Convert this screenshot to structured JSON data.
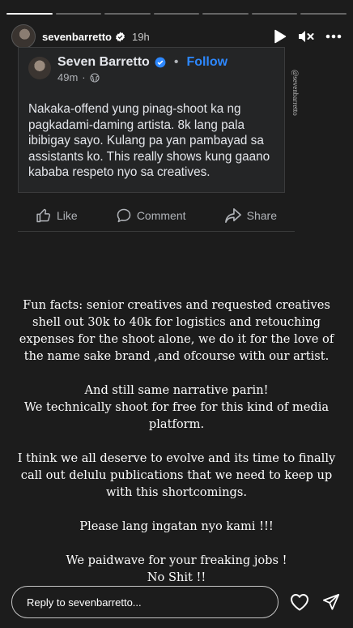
{
  "story": {
    "segments_total": 7,
    "segments_viewed": 1,
    "username": "sevenbarretto",
    "verified": true,
    "time_ago": "19h"
  },
  "shared_post": {
    "author": "Seven Barretto",
    "follow_label": "Follow",
    "separator": "•",
    "time_ago": "49m",
    "visibility_icon": "globe-icon",
    "text": "Nakaka-offend yung pinag-shoot ka ng pagkadami-daming artista. 8k lang pala ibibigay sayo. Kulang pa yan pambayad sa assistants ko. This really shows kung gaano kababa respeto nyo sa creatives.",
    "actions": {
      "like": "Like",
      "comment": "Comment",
      "share": "Share"
    }
  },
  "watermark": "@sevenbarretto",
  "story_text": {
    "p1": "Fun facts: senior creatives and requested creatives shell out 30k to 40k for logistics and retouching expenses for the shoot alone, we do it for the love of the name sake brand ,and ofcourse with our artist.",
    "p2a": "And still same narrative parin!",
    "p2b": "We technically shoot for free for this kind of media platform.",
    "p3": "I think we all deserve to evolve and its time to finally call out delulu publications  that we need to keep up with this shortcomings.",
    "p4": "Please lang ingatan nyo kami !!!",
    "p5a": "We paidwave for your freaking jobs !",
    "p5b": "No Shit !!"
  },
  "footer": {
    "reply_placeholder": "Reply to sevenbarretto..."
  },
  "colors": {
    "background": "#1c1c1c",
    "card": "#242526",
    "follow": "#2d88ff",
    "verified": "#2d88ff"
  }
}
